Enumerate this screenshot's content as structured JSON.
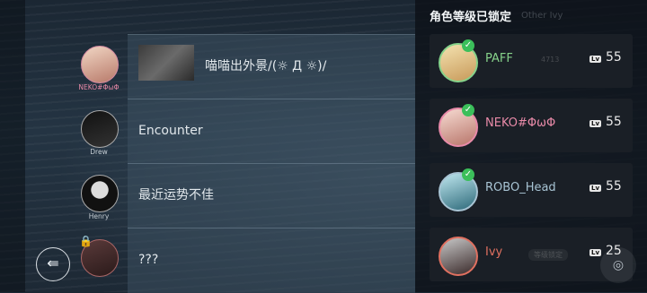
{
  "panel_title": "角色等级已锁定",
  "rows": [
    {
      "name": "NEKO#ΦωΦ",
      "title": "喵喵出外景/(☼ Д ☼)/"
    },
    {
      "name": "Drew",
      "title": "Encounter"
    },
    {
      "name": "Henry",
      "title": "最近运势不佳"
    },
    {
      "name": "",
      "title": "???"
    }
  ],
  "cards": [
    {
      "name": "PAFF",
      "lv_label": "Lv",
      "level": "55",
      "ghost": "4713",
      "color": "#86d28a"
    },
    {
      "name": "NEKO#ΦωΦ",
      "lv_label": "Lv",
      "level": "55",
      "ghost": "",
      "color": "#e88aa8"
    },
    {
      "name": "ROBO_Head",
      "lv_label": "Lv",
      "level": "55",
      "ghost": "",
      "color": "#a8c4d4"
    },
    {
      "name": "Ivy",
      "lv_label": "Lv",
      "level": "25",
      "ghost": "等级锁定",
      "color": "#e07060"
    }
  ],
  "ghost_top": "Other Ivy"
}
